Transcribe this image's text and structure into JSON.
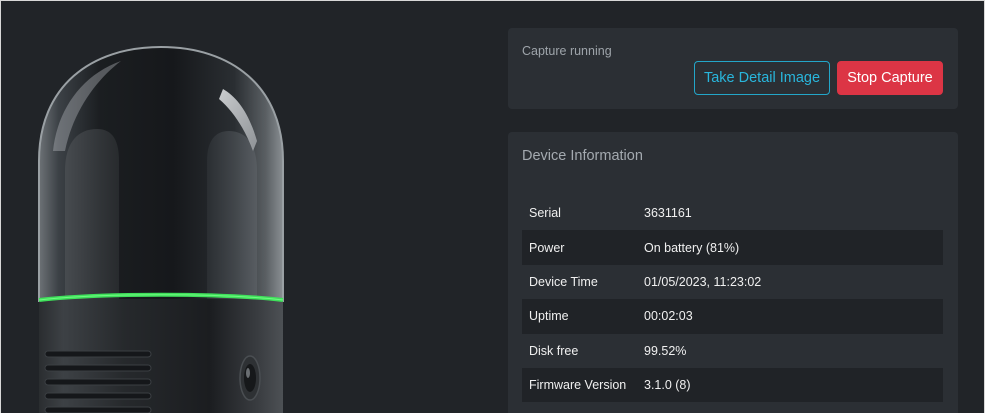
{
  "status": {
    "text": "Capture running",
    "take_detail_label": "Take Detail Image",
    "stop_label": "Stop Capture"
  },
  "device_info": {
    "title": "Device Information",
    "rows": [
      {
        "key": "Serial",
        "value": "3631161"
      },
      {
        "key": "Power",
        "value": "On battery (81%)"
      },
      {
        "key": "Device Time",
        "value": "01/05/2023, 11:23:02"
      },
      {
        "key": "Uptime",
        "value": "00:02:03"
      },
      {
        "key": "Disk free",
        "value": "99.52%"
      },
      {
        "key": "Firmware Version",
        "value": "3.1.0 (8)"
      }
    ]
  },
  "device_image": {
    "status_ring_color": "#3ee05a"
  },
  "colors": {
    "background": "#212428",
    "card": "#2b2f34",
    "accent_outline": "#29b6dc",
    "danger": "#dc3545"
  }
}
